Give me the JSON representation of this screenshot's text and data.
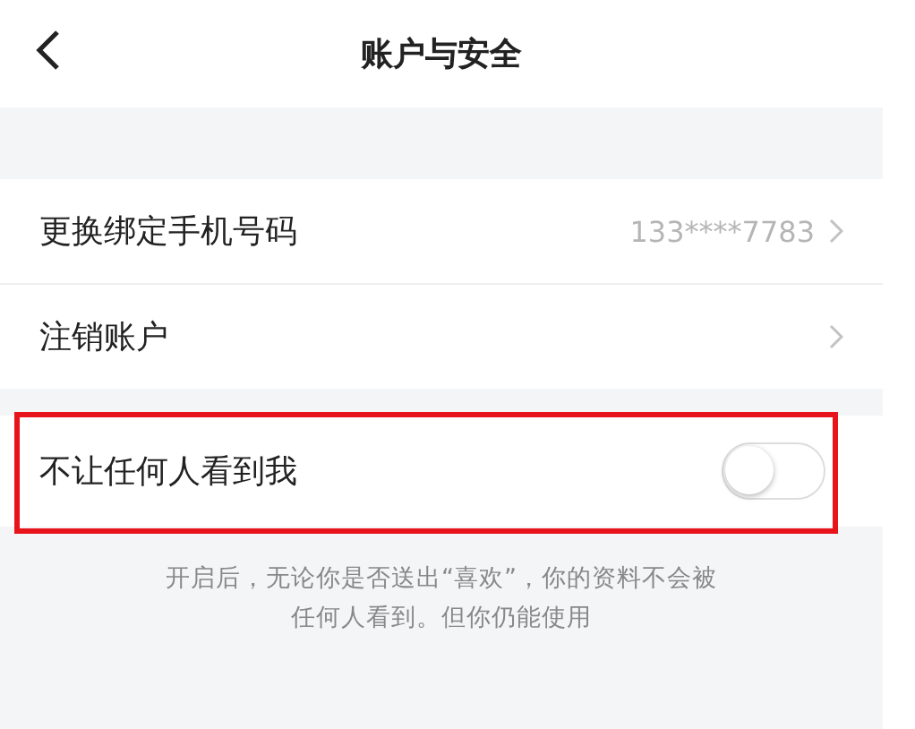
{
  "header": {
    "title": "账户与安全"
  },
  "items": [
    {
      "kind": "link",
      "label": "更换绑定手机号码",
      "value": "133****7783"
    },
    {
      "kind": "link",
      "label": "注销账户"
    }
  ],
  "privacy": {
    "label": "不让任何人看到我",
    "on": false,
    "highlighted": true
  },
  "note": [
    "开启后，无论你是否送出“喜欢”，你的资料不会被",
    "任何人看到。但你仍能使用"
  ]
}
